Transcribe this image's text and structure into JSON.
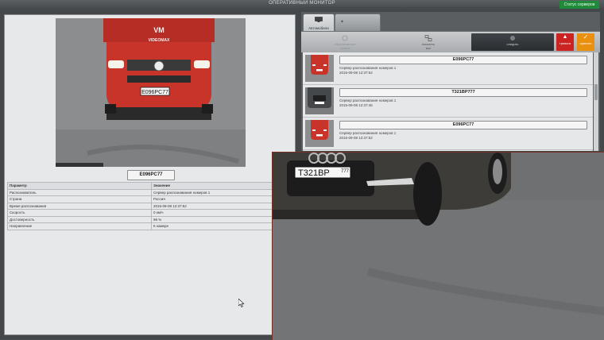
{
  "window": {
    "title": "ОПЕРАТИВНЫЙ МОНИТОР",
    "server_status_button": "Статус серверов"
  },
  "detail": {
    "photo": {
      "brand_text": "VIDEOMAX",
      "plate_on_car": "E096PC77"
    },
    "plate_value": "E096PC77",
    "table": {
      "headers": [
        "Параметр",
        "Значение"
      ],
      "rows": [
        [
          "Распознаватель",
          "Сервер распознавания номеров 1"
        ],
        [
          "Страна",
          "Россия"
        ],
        [
          "Время распознавания",
          "2015-09-08 12:37:52"
        ],
        [
          "Скорость",
          "0 км/ч"
        ],
        [
          "Достоверность",
          "98 %"
        ],
        [
          "Направление",
          "К камере"
        ]
      ]
    }
  },
  "tabs": [
    {
      "label": "Автомобили",
      "icon": "monitor-icon",
      "active": true
    },
    {
      "label": "",
      "icon": "star-icon",
      "active": false
    }
  ],
  "toolbar": {
    "items": [
      {
        "label": "обработанные\nзаписи",
        "icon": "refresh-icon",
        "state": "disabled"
      },
      {
        "label": "показать\nвсе",
        "icon": "network-icon",
        "state": "normal"
      },
      {
        "label": "следить",
        "icon": "record-icon",
        "state": "selected"
      }
    ],
    "alarm_label": "тревога",
    "accept_label": "принять"
  },
  "recognitions": [
    {
      "plate": "E096PC77",
      "source": "Сервер распознавания номеров 1",
      "time": "2015-09-08 12:37:52",
      "thumb": "red-van"
    },
    {
      "plate": "T321BP777",
      "source": "Сервер распознавания номеров 1",
      "time": "2015-09-08 12:37:46",
      "thumb": "grey-car"
    },
    {
      "plate": "E096PC77",
      "source": "Сервер распознавания номеров 1",
      "time": "2015-09-08 12:37:52",
      "thumb": "red-van"
    }
  ],
  "zoom_view": {
    "plate_on_car": "T321BP777",
    "plate_main": "T321BP",
    "plate_region": "777"
  },
  "colors": {
    "accent_green": "#1f8a3a",
    "alarm_red": "#cc2222",
    "accept_orange": "#e9900f",
    "van_red": "#c8342a"
  }
}
